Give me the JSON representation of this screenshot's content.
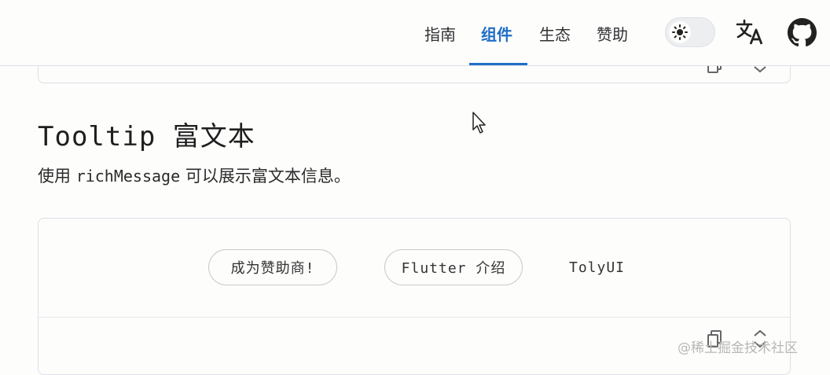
{
  "nav": {
    "items": [
      {
        "label": "指南",
        "active": false
      },
      {
        "label": "组件",
        "active": true
      },
      {
        "label": "生态",
        "active": false
      },
      {
        "label": "赞助",
        "active": false
      }
    ],
    "theme_toggle_icon": "sun-icon",
    "translate_icon": "translate-icon",
    "github_icon": "github-icon",
    "accent_color": "#1f6fc6"
  },
  "section": {
    "title": "Tooltip 富文本",
    "desc_prefix": "使用",
    "desc_code": "richMessage",
    "desc_suffix": "可以展示富文本信息。"
  },
  "demo": {
    "buttons": [
      "成为赞助商!",
      "Flutter 介绍"
    ],
    "link": "TolyUI"
  },
  "watermark": "@稀土掘金技术社区"
}
